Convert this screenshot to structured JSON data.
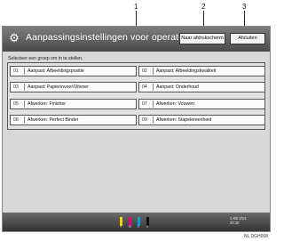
{
  "callouts": [
    "1",
    "2",
    "3"
  ],
  "header": {
    "title": "Aanpassingsinstellingen voor operators",
    "button_main_screen": "Naar afdrukscherm",
    "button_exit": "Afsluiten"
  },
  "prompt": "Selecteer een groep om in te stellen.",
  "groups": [
    {
      "num": "01",
      "label": "Aanpast: Afbeeldingspositie"
    },
    {
      "num": "02",
      "label": "Aanpast: Afbeeldingskwaliteit"
    },
    {
      "num": "03",
      "label": "Aanpast: Papierinvoer/Uitvoer"
    },
    {
      "num": "04",
      "label": "Aanpast: Onderhoud"
    },
    {
      "num": "05",
      "label": "Afwerken: Finisher"
    },
    {
      "num": "07",
      "label": "Afwerken: Vouwen"
    },
    {
      "num": "08",
      "label": "Afwerken: Perfect Binder"
    },
    {
      "num": "09",
      "label": "Afwerken: Stapelereenheid"
    }
  ],
  "status": {
    "toner_labels": [
      "Y",
      "M",
      "C",
      "K"
    ],
    "toner_colors": [
      "#f2d400",
      "#e6007e",
      "#00a0e0",
      "#111111"
    ],
    "line1": "1 KB  2/14",
    "line2": "20:10"
  },
  "figure_id": "NL DGH008"
}
